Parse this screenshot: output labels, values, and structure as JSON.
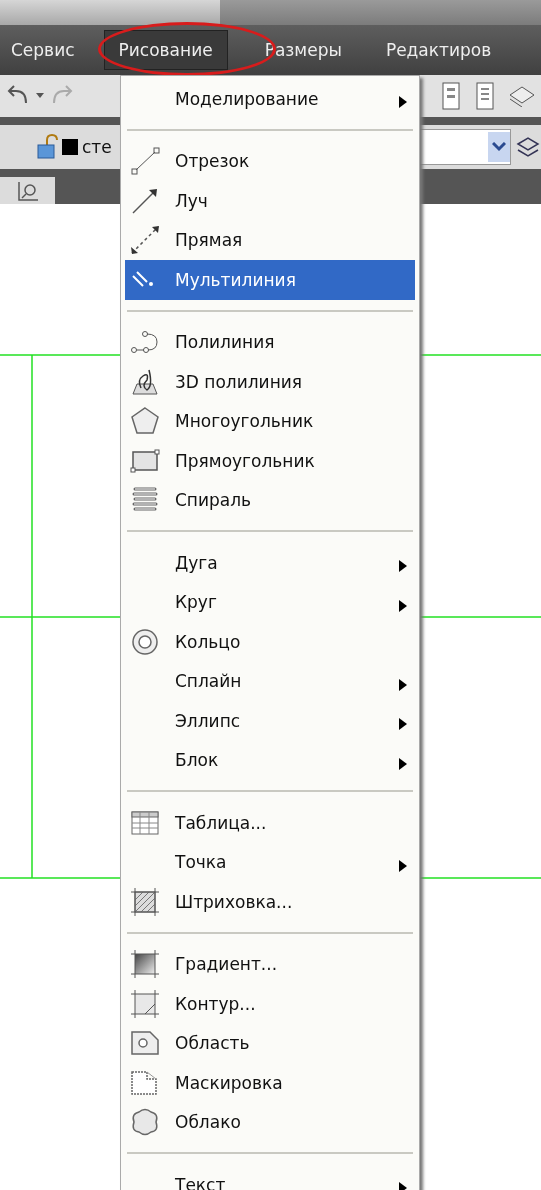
{
  "menubar": {
    "items": [
      {
        "label": "Сервис",
        "selected": false
      },
      {
        "label": "Рисование",
        "selected": true
      },
      {
        "label": "Размеры",
        "selected": false
      },
      {
        "label": "Редактиров",
        "selected": false
      }
    ]
  },
  "layer_bar": {
    "layer_name": "сте"
  },
  "menu": {
    "sections": [
      [
        {
          "label": "Моделирование",
          "selected": false,
          "has_submenu": true
        }
      ],
      [
        {
          "label": "Отрезок",
          "selected": false,
          "has_submenu": false
        },
        {
          "label": "Луч",
          "selected": false,
          "has_submenu": false
        },
        {
          "label": "Прямая",
          "selected": false,
          "has_submenu": false
        },
        {
          "label": "Мультилиния",
          "selected": true,
          "has_submenu": false
        }
      ],
      [
        {
          "label": "Полилиния",
          "selected": false,
          "has_submenu": false
        },
        {
          "label": "3D полилиния",
          "selected": false,
          "has_submenu": false
        },
        {
          "label": "Многоугольник",
          "selected": false,
          "has_submenu": false
        },
        {
          "label": "Прямоугольник",
          "selected": false,
          "has_submenu": false
        },
        {
          "label": "Спираль",
          "selected": false,
          "has_submenu": false
        }
      ],
      [
        {
          "label": "Дуга",
          "selected": false,
          "has_submenu": true
        },
        {
          "label": "Круг",
          "selected": false,
          "has_submenu": true
        },
        {
          "label": "Кольцо",
          "selected": false,
          "has_submenu": false
        },
        {
          "label": "Сплайн",
          "selected": false,
          "has_submenu": true
        },
        {
          "label": "Эллипс",
          "selected": false,
          "has_submenu": true
        },
        {
          "label": "Блок",
          "selected": false,
          "has_submenu": true
        }
      ],
      [
        {
          "label": "Таблица...",
          "selected": false,
          "has_submenu": false
        },
        {
          "label": "Точка",
          "selected": false,
          "has_submenu": true
        },
        {
          "label": "Штриховка...",
          "selected": false,
          "has_submenu": false
        }
      ],
      [
        {
          "label": "Градиент...",
          "selected": false,
          "has_submenu": false
        },
        {
          "label": "Контур...",
          "selected": false,
          "has_submenu": false
        },
        {
          "label": "Область",
          "selected": false,
          "has_submenu": false
        },
        {
          "label": "Маскировка",
          "selected": false,
          "has_submenu": false
        },
        {
          "label": "Облако",
          "selected": false,
          "has_submenu": false
        }
      ],
      [
        {
          "label": "Текст",
          "selected": false,
          "has_submenu": true
        }
      ]
    ]
  }
}
